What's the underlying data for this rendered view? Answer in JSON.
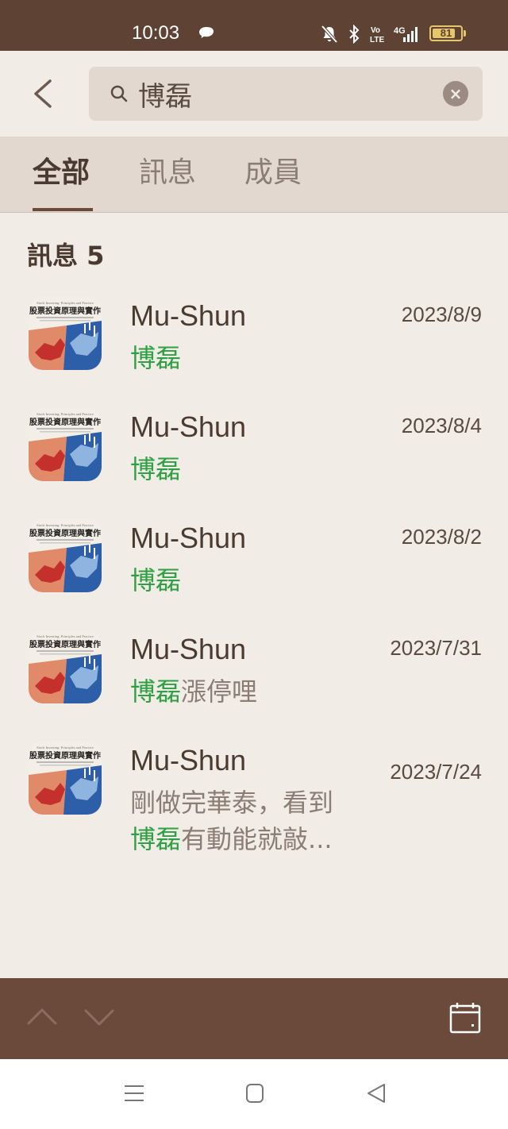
{
  "status_bar": {
    "time": "10:03",
    "battery": "81",
    "battery_level": 0.81
  },
  "search": {
    "query": "博磊",
    "back_icon": "chevron-left-icon",
    "search_icon": "search-icon",
    "clear_icon": "close-icon",
    "clear_symbol": "×"
  },
  "tabs": [
    {
      "label": "全部",
      "active": true
    },
    {
      "label": "訊息",
      "active": false
    },
    {
      "label": "成員",
      "active": false
    }
  ],
  "section": {
    "title": "訊息 5"
  },
  "messages": [
    {
      "name": "Mu-Shun",
      "date": "2023/8/9",
      "highlight": "博磊",
      "line1_pre": "",
      "line1_rest": "",
      "rest": ""
    },
    {
      "name": "Mu-Shun",
      "date": "2023/8/4",
      "highlight": "博磊",
      "line1_pre": "",
      "rest": ""
    },
    {
      "name": "Mu-Shun",
      "date": "2023/8/2",
      "highlight": "博磊",
      "line1_pre": "",
      "rest": ""
    },
    {
      "name": "Mu-Shun",
      "date": "2023/7/31",
      "highlight": "博磊",
      "line1_pre": "",
      "rest": "漲停哩"
    },
    {
      "name": "Mu-Shun",
      "date": "2023/7/24",
      "highlight": "博磊",
      "line1_pre": "剛做完華泰，看到",
      "rest": "有動能就敲..."
    }
  ],
  "avatar": {
    "book_title": "股票投資原理與實作",
    "book_subtitle": "Stock Investing: Principles and Practice"
  },
  "colors": {
    "status_bar": "#5e4335",
    "toolbar": "#6b4a3c",
    "highlight": "#2ea043",
    "background": "#f1ece6"
  }
}
